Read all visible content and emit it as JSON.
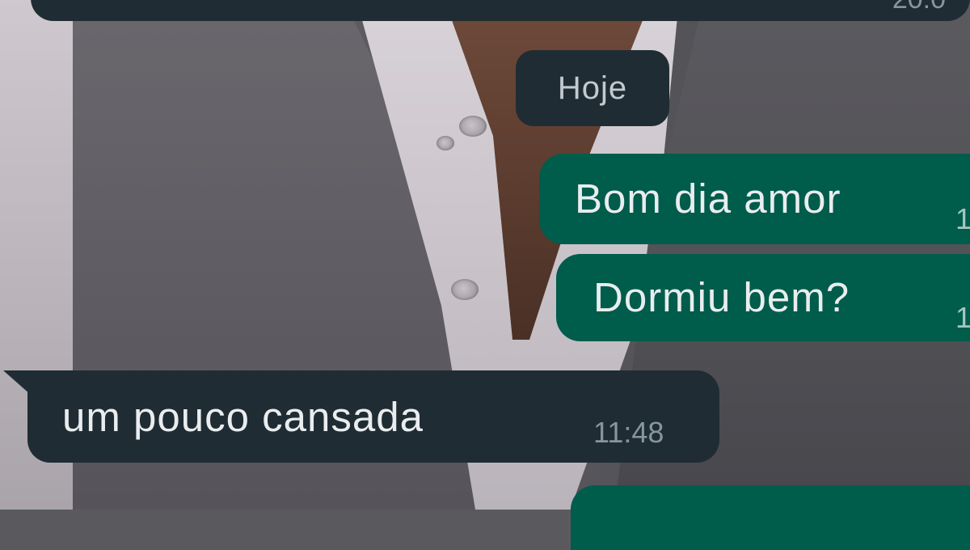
{
  "chat": {
    "previous_message": {
      "time": "20:0"
    },
    "date_separator": "Hoje",
    "messages": [
      {
        "direction": "outgoing",
        "text": "Bom dia amor",
        "time": "1"
      },
      {
        "direction": "outgoing",
        "text": "Dormiu bem?",
        "time": "1"
      },
      {
        "direction": "incoming",
        "text": "um pouco cansada",
        "time": "11:48"
      }
    ]
  },
  "colors": {
    "incoming_bubble": "#202c33",
    "outgoing_bubble": "#005c4b",
    "message_text": "#e9edef",
    "timestamp": "#8696a0"
  }
}
